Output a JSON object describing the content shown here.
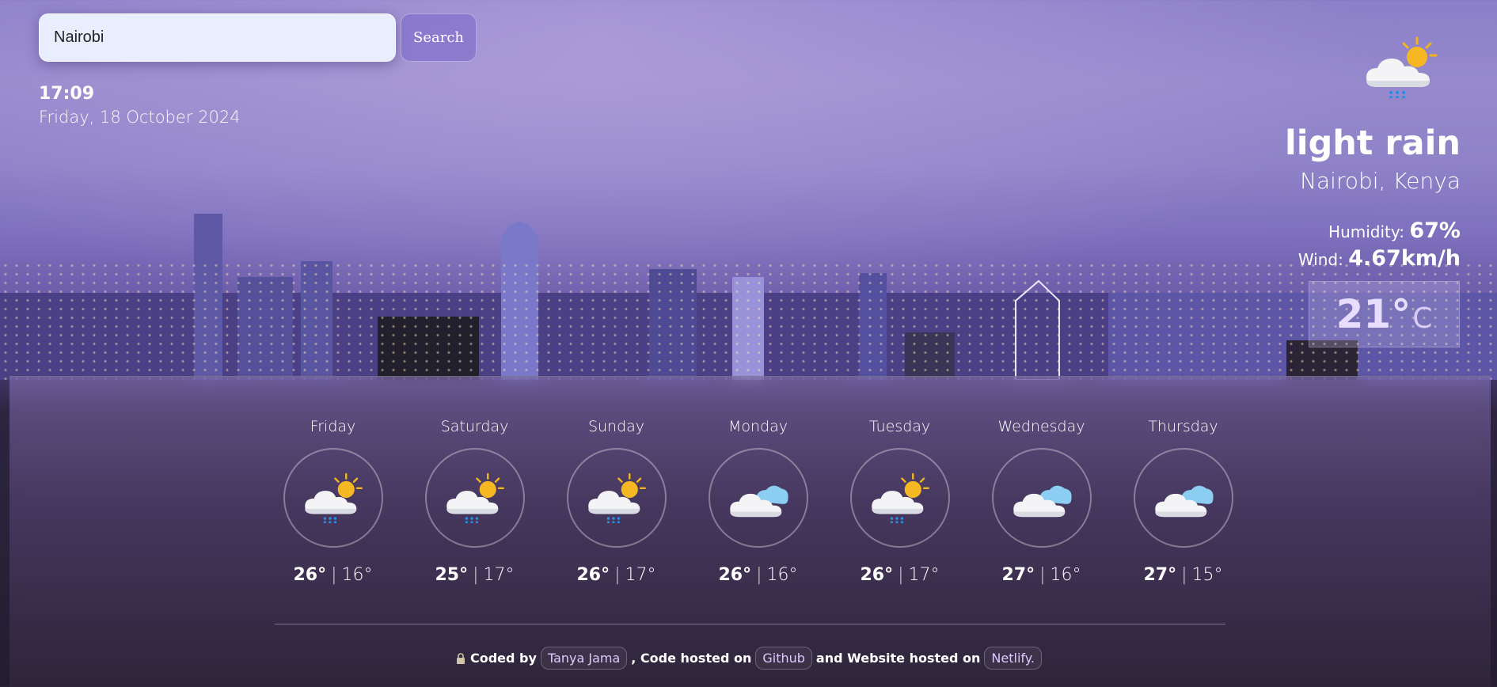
{
  "search": {
    "value": "Nairobi",
    "button_label": "Search"
  },
  "clock": {
    "time": "17:09",
    "date": "Friday, 18 October 2024"
  },
  "current": {
    "icon": "light-rain-icon",
    "condition": "light rain",
    "location": "Nairobi, Kenya",
    "humidity_label": "Humidity:",
    "humidity_value": "67%",
    "wind_label": "Wind:",
    "wind_value": "4.67km/h",
    "temperature": "21°",
    "unit": "C"
  },
  "forecast": [
    {
      "day": "Friday",
      "icon": "light-rain-icon",
      "high": "26°",
      "low": "16°"
    },
    {
      "day": "Saturday",
      "icon": "light-rain-icon",
      "high": "25°",
      "low": "17°"
    },
    {
      "day": "Sunday",
      "icon": "light-rain-icon",
      "high": "26°",
      "low": "17°"
    },
    {
      "day": "Monday",
      "icon": "cloud-icon",
      "high": "26°",
      "low": "16°"
    },
    {
      "day": "Tuesday",
      "icon": "light-rain-icon",
      "high": "26°",
      "low": "17°"
    },
    {
      "day": "Wednesday",
      "icon": "cloud-icon",
      "high": "27°",
      "low": "16°"
    },
    {
      "day": "Thursday",
      "icon": "cloud-icon",
      "high": "27°",
      "low": "15°"
    }
  ],
  "forecast_separator": "|",
  "footer": {
    "coded_by": "Coded by",
    "author": "Tanya Jama",
    "code_hosted": ", Code hosted on",
    "github": "Github",
    "website_hosted": "and Website hosted on",
    "netlify": "Netlify."
  }
}
